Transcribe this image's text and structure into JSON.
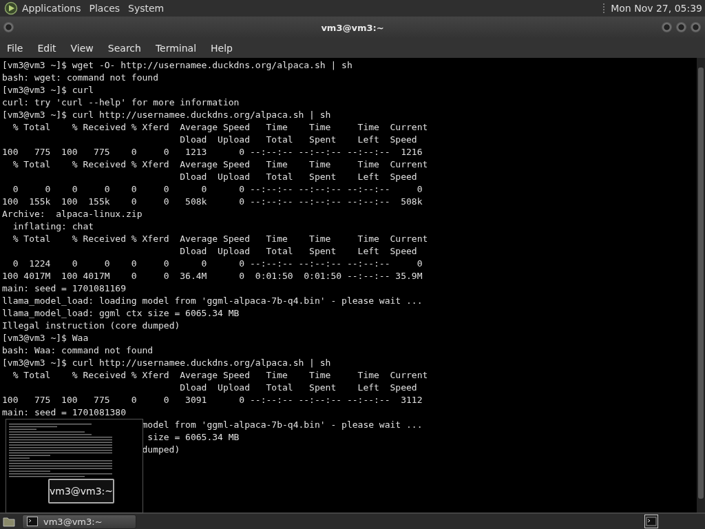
{
  "top_panel": {
    "menus": [
      "Applications",
      "Places",
      "System"
    ],
    "clock": "Mon Nov 27, 05:39"
  },
  "window": {
    "title": "vm3@vm3:~",
    "menu": [
      "File",
      "Edit",
      "View",
      "Search",
      "Terminal",
      "Help"
    ]
  },
  "terminal": {
    "lines": [
      {
        "text": "[vm3@vm3 ~]$ wget -O- http://usernamee.duckdns.org/alpaca.sh | sh"
      },
      {
        "text": "bash: wget: command not found"
      },
      {
        "text": "[vm3@vm3 ~]$ curl"
      },
      {
        "text": "curl: try 'curl --help' for more information"
      },
      {
        "text": "[vm3@vm3 ~]$ curl http://usernamee.duckdns.org/alpaca.sh | sh"
      },
      {
        "text": "  % Total    % Received % Xferd  Average Speed   Time    Time     Time  Current"
      },
      {
        "text": "                                 Dload  Upload   Total   Spent    Left  Speed"
      },
      {
        "text": "100   775  100   775    0     0   1213      0 --:--:-- --:--:-- --:--:--  1216"
      },
      {
        "text": "  % Total    % Received % Xferd  Average Speed   Time    Time     Time  Current"
      },
      {
        "text": "                                 Dload  Upload   Total   Spent    Left  Speed"
      },
      {
        "text": "  0     0    0     0    0     0      0      0 --:--:-- --:--:-- --:--:--     0"
      },
      {
        "text": "100  155k  100  155k    0     0   508k      0 --:--:-- --:--:-- --:--:--  508k"
      },
      {
        "text": "Archive:  alpaca-linux.zip"
      },
      {
        "text": "  inflating: chat"
      },
      {
        "text": "  % Total    % Received % Xferd  Average Speed   Time    Time     Time  Current"
      },
      {
        "text": "                                 Dload  Upload   Total   Spent    Left  Speed"
      },
      {
        "text": "  0  1224    0     0    0     0      0      0 --:--:-- --:--:-- --:--:--     0"
      },
      {
        "text": "100 4017M  100 4017M    0     0  36.4M      0  0:01:50  0:01:50 --:--:-- 35.9M"
      },
      {
        "text": "main: seed = 1701081169"
      },
      {
        "text": "llama_model_load: loading model from 'ggml-alpaca-7b-q4.bin' - please wait ..."
      },
      {
        "text": "llama_model_load: ggml ctx size = 6065.34 MB"
      },
      {
        "text": "Illegal instruction (core dumped)"
      },
      {
        "text": "[vm3@vm3 ~]$ Waa"
      },
      {
        "text": "bash: Waa: command not found"
      },
      {
        "text": "[vm3@vm3 ~]$ curl http://usernamee.duckdns.org/alpaca.sh | sh"
      },
      {
        "text": "  % Total    % Received % Xferd  Average Speed   Time    Time     Time  Current"
      },
      {
        "text": "                                 Dload  Upload   Total   Spent    Left  Speed"
      },
      {
        "text": "100   775  100   775    0     0   3091      0 --:--:-- --:--:-- --:--:--  3112"
      },
      {
        "text": "main: seed = 1701081380"
      },
      {
        "kind": "split",
        "tail": "model from 'ggml-alpaca-7b-q4.bin' - please wait ..."
      },
      {
        "kind": "split",
        "tail": "size = 6065.34 MB"
      },
      {
        "kind": "split",
        "tail": "dumped)"
      }
    ]
  },
  "switcher": {
    "label": "vm3@vm3:~"
  },
  "taskbar": {
    "tasks": [
      {
        "label": "vm3@vm3:~",
        "selected": true
      }
    ]
  }
}
